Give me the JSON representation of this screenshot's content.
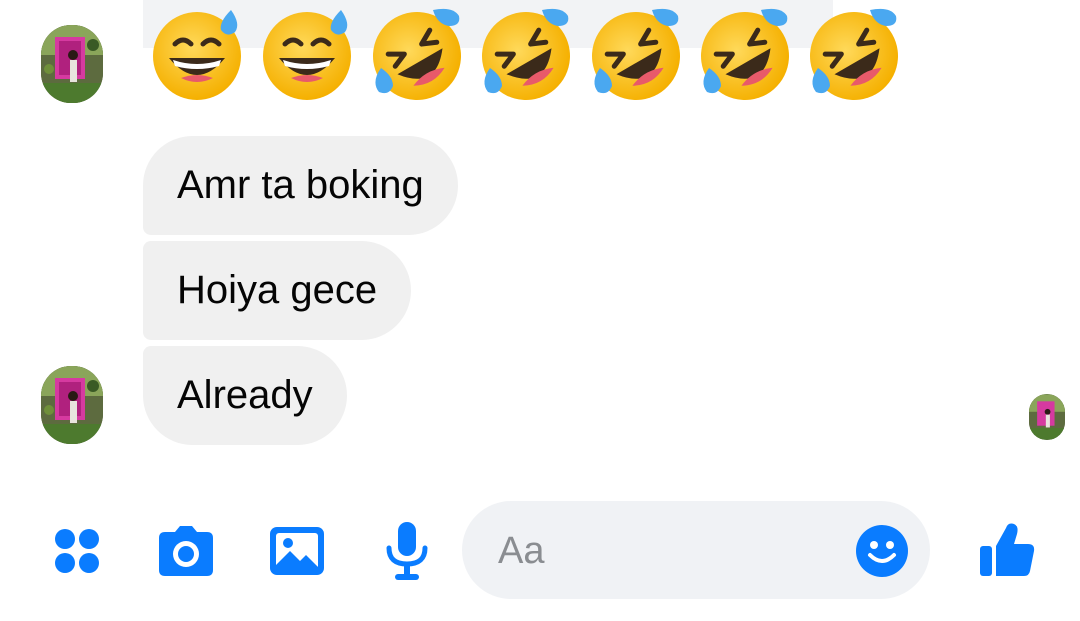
{
  "emoji_message": [
    "😅",
    "😅",
    "🤣",
    "🤣",
    "🤣",
    "🤣",
    "🤣"
  ],
  "messages": [
    {
      "text": "Amr ta boking"
    },
    {
      "text": "Hoiya gece"
    },
    {
      "text": "Already"
    }
  ],
  "composer": {
    "placeholder": "Aa",
    "icons": [
      "apps-icon",
      "camera-icon",
      "gallery-icon",
      "microphone-icon",
      "emoji-icon",
      "thumbs-up-icon"
    ]
  },
  "colors": {
    "accent": "#0a7cff",
    "bubble": "#f0f0f0",
    "input_bg": "#f0f2f5",
    "placeholder": "#8a8d91"
  }
}
